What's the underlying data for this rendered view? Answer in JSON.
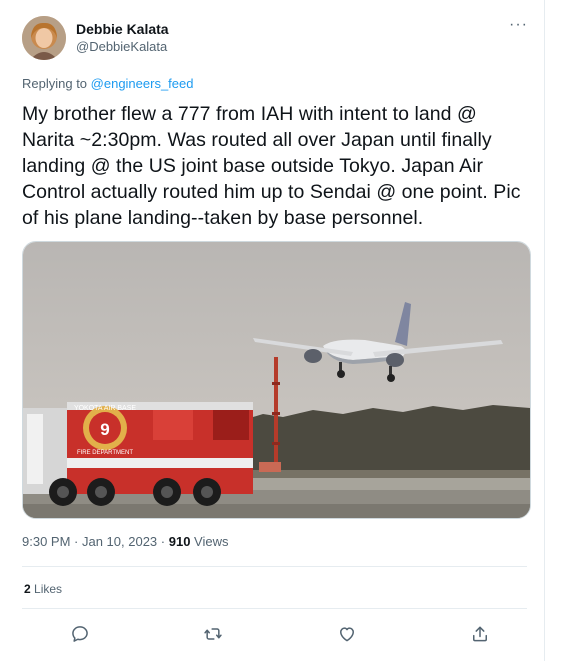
{
  "author": {
    "display_name": "Debbie Kalata",
    "handle": "@DebbieKalata"
  },
  "more_label": "···",
  "reply": {
    "prefix": "Replying to ",
    "target": "@engineers_feed"
  },
  "tweet_text": "My brother flew a 777 from IAH with intent to land @ Narita ~2:30pm. Was routed all over Japan until finally landing @ the US joint base outside Tokyo. Japan Air Control actually routed him up to Sendai @ one point. Pic of his plane landing--taken by base personnel.",
  "media": {
    "truck_text_top": "YOKOTA AIR BASE",
    "truck_number": "9",
    "truck_text_bottom": "FIRE DEPARTMENT"
  },
  "meta": {
    "time": "9:30 PM",
    "separator": " · ",
    "date": "Jan 10, 2023",
    "views_count": "910",
    "views_label": " Views"
  },
  "engagement": {
    "likes_count": "2",
    "likes_label": " Likes"
  },
  "actions": [
    "reply-icon",
    "retweet-icon",
    "like-icon",
    "share-icon"
  ],
  "colors": {
    "accent": "#1d9bf0",
    "text": "#0f1419",
    "secondary": "#536471",
    "border": "#e6ecf0"
  }
}
